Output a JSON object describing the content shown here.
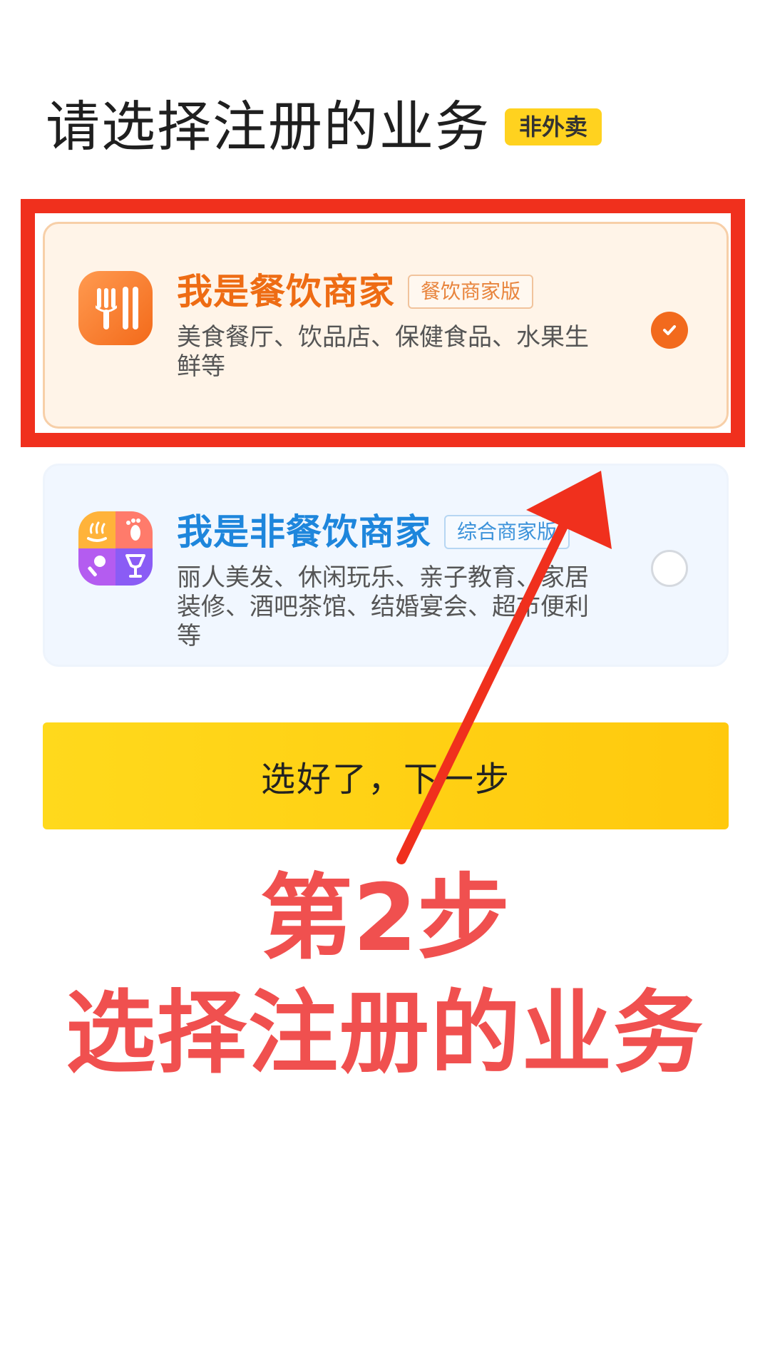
{
  "header": {
    "title": "请选择注册的业务",
    "tag": "非外卖"
  },
  "options": [
    {
      "title": "我是餐饮商家",
      "badge": "餐饮商家版",
      "description": "美食餐厅、饮品店、保健食品、水果生鲜等",
      "selected": true,
      "icon": "fork-knife-icon"
    },
    {
      "title": "我是非餐饮商家",
      "badge": "综合商家版",
      "description": "丽人美发、休闲玩乐、亲子教育、家居装修、酒吧茶馆、结婚宴会、超市便利等",
      "selected": false,
      "icon": "multi-category-icon"
    }
  ],
  "next_button": {
    "label": "选好了，下一步"
  },
  "annotation": {
    "step": "第2步",
    "caption": "选择注册的业务"
  },
  "colors": {
    "accent_yellow": "#ffd21f",
    "food_orange": "#ee6c14",
    "nonfood_blue": "#1e86dc",
    "annotation_red": "#f0301d"
  }
}
